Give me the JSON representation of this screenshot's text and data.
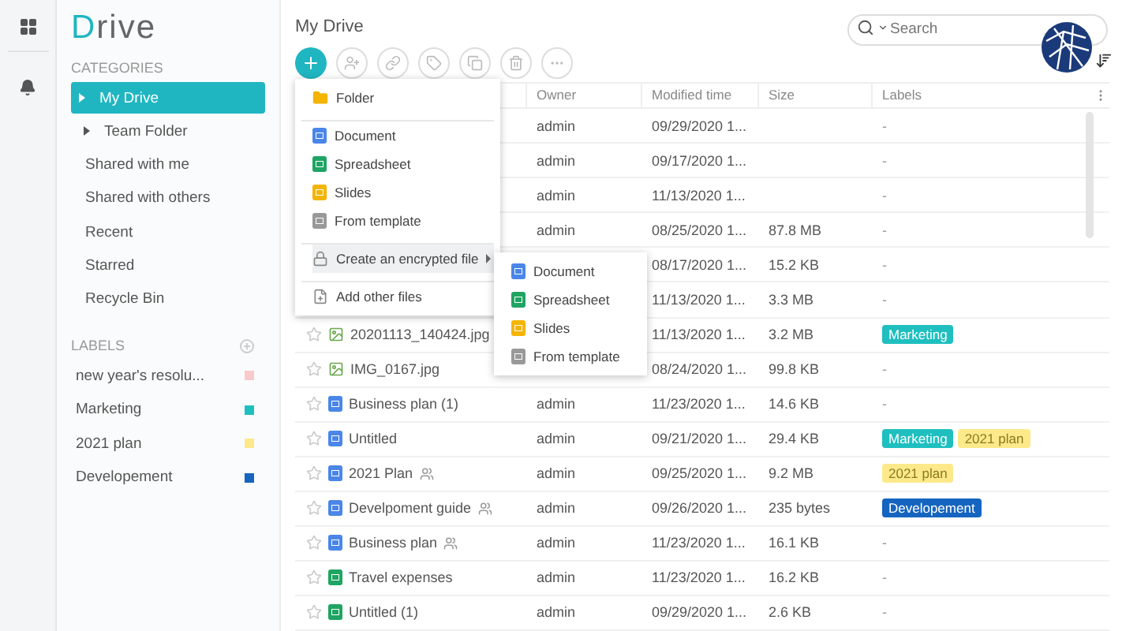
{
  "logo": "Drive",
  "sidebar": {
    "categories_heading": "CATEGORIES",
    "categories": [
      {
        "label": "My Drive",
        "selected": true,
        "expandable": true
      },
      {
        "label": "Team Folder",
        "selected": false,
        "expandable": true
      },
      {
        "label": "Shared with me",
        "selected": false,
        "expandable": false
      },
      {
        "label": "Shared with others",
        "selected": false,
        "expandable": false
      },
      {
        "label": "Recent",
        "selected": false,
        "expandable": false
      },
      {
        "label": "Starred",
        "selected": false,
        "expandable": false
      },
      {
        "label": "Recycle Bin",
        "selected": false,
        "expandable": false
      }
    ],
    "labels_heading": "LABELS",
    "labels": [
      {
        "label": "new year's resolu...",
        "color": "#f9c9cc"
      },
      {
        "label": "Marketing",
        "color": "#1fbfbf"
      },
      {
        "label": "2021 plan",
        "color": "#fde98a"
      },
      {
        "label": "Developement",
        "color": "#1565c0"
      }
    ]
  },
  "title": "My Drive",
  "search": {
    "placeholder": "Search"
  },
  "table": {
    "columns": [
      "Owner",
      "Modified time",
      "Size",
      "Labels"
    ],
    "rows": [
      {
        "owner": "admin",
        "modified": "09/29/2020 1...",
        "labels": [
          {
            "text": "-"
          }
        ]
      },
      {
        "owner": "admin",
        "modified": "09/17/2020 1...",
        "labels": [
          {
            "text": "-"
          }
        ]
      },
      {
        "owner": "admin",
        "modified": "11/13/2020 1...",
        "labels": [
          {
            "text": "-"
          }
        ]
      },
      {
        "owner": "admin",
        "modified": "08/25/2020 1...",
        "size": "87.8 MB",
        "labels": [
          {
            "text": "-"
          }
        ]
      },
      {
        "modified": "08/17/2020 1...",
        "size": "15.2 KB",
        "labels": [
          {
            "text": "-"
          }
        ]
      },
      {
        "modified": "11/13/2020 1...",
        "size": "3.3 MB",
        "labels": [
          {
            "text": "-"
          }
        ]
      },
      {
        "name": "20201113_140424.jpg",
        "kind": "image",
        "modified": "11/13/2020 1...",
        "size": "3.2 MB",
        "labels": [
          {
            "text": "Marketing",
            "color": "#1fbfbf"
          }
        ]
      },
      {
        "name": "IMG_0167.jpg",
        "kind": "image",
        "modified": "08/24/2020 1...",
        "size": "99.8 KB",
        "labels": [
          {
            "text": "-"
          }
        ]
      },
      {
        "name": "Business plan (1)",
        "kind": "doc",
        "owner": "admin",
        "modified": "11/23/2020 1...",
        "size": "14.6 KB",
        "labels": [
          {
            "text": "-"
          }
        ]
      },
      {
        "name": "Untitled",
        "kind": "doc",
        "owner": "admin",
        "modified": "09/21/2020 1...",
        "size": "29.4 KB",
        "labels": [
          {
            "text": "Marketing",
            "color": "#1fbfbf"
          },
          {
            "text": "2021 plan",
            "color": "#fde98a"
          }
        ]
      },
      {
        "name": "2021 Plan",
        "kind": "doc",
        "shared": true,
        "owner": "admin",
        "modified": "09/25/2020 1...",
        "size": "9.2 MB",
        "labels": [
          {
            "text": "2021 plan",
            "color": "#fde98a"
          }
        ]
      },
      {
        "name": "Develpoment guide",
        "kind": "doc",
        "shared": true,
        "owner": "admin",
        "modified": "09/26/2020 1...",
        "size": "235 bytes",
        "labels": [
          {
            "text": "Developement",
            "color": "#1565c0"
          }
        ]
      },
      {
        "name": "Business plan",
        "kind": "doc",
        "shared": true,
        "owner": "admin",
        "modified": "11/23/2020 1...",
        "size": "16.1 KB",
        "labels": [
          {
            "text": "-"
          }
        ]
      },
      {
        "name": "Travel expenses",
        "kind": "sheet",
        "owner": "admin",
        "modified": "11/23/2020 1...",
        "size": "16.2 KB",
        "labels": [
          {
            "text": "-"
          }
        ]
      },
      {
        "name": "Untitled (1)",
        "kind": "sheet",
        "owner": "admin",
        "modified": "09/29/2020 1...",
        "size": "2.6 KB",
        "labels": [
          {
            "text": "-"
          }
        ]
      }
    ]
  },
  "new_menu": {
    "items": [
      {
        "kind": "folder",
        "label": "Folder",
        "divider_after": true
      },
      {
        "kind": "doc",
        "label": "Document"
      },
      {
        "kind": "sheet",
        "label": "Spreadsheet"
      },
      {
        "kind": "slides",
        "label": "Slides"
      },
      {
        "kind": "template",
        "label": "From template",
        "divider_after": true
      },
      {
        "kind": "lock",
        "label": "Create an encrypted file",
        "submenu": true,
        "selected": true,
        "divider_after": true
      },
      {
        "kind": "add",
        "label": "Add other files",
        "selected": false
      }
    ],
    "submenu": [
      {
        "kind": "doc",
        "label": "Document"
      },
      {
        "kind": "sheet",
        "label": "Spreadsheet"
      },
      {
        "kind": "slides",
        "label": "Slides"
      },
      {
        "kind": "template",
        "label": "From template"
      }
    ]
  }
}
